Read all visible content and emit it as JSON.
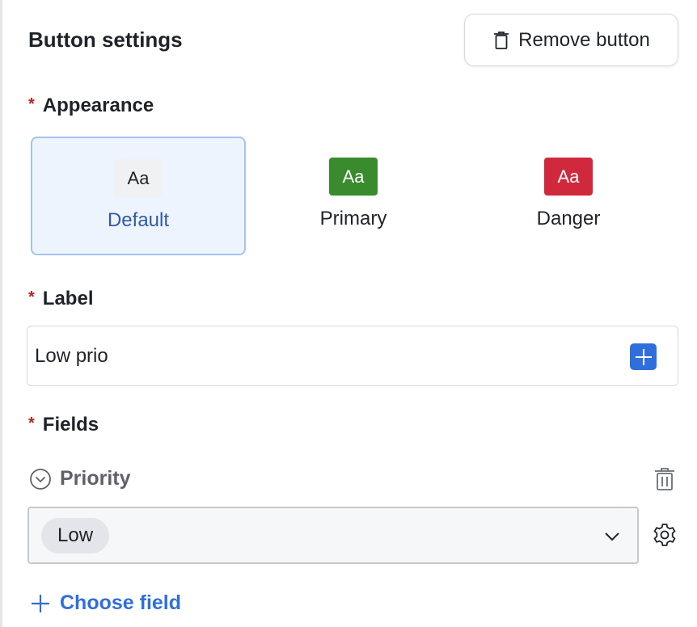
{
  "header": {
    "title": "Button settings",
    "remove_label": "Remove button"
  },
  "appearance": {
    "label": "Appearance",
    "required_mark": "*",
    "sample_text": "Aa",
    "options": [
      {
        "name": "Default",
        "selected": true,
        "color": "#f0f1f3"
      },
      {
        "name": "Primary",
        "selected": false,
        "color": "#3a8a2e"
      },
      {
        "name": "Danger",
        "selected": false,
        "color": "#d0293e"
      }
    ]
  },
  "label_field": {
    "label": "Label",
    "required_mark": "*",
    "value": "Low prio"
  },
  "fields": {
    "label": "Fields",
    "required_mark": "*",
    "items": [
      {
        "name": "Priority",
        "value": "Low"
      }
    ],
    "choose_label": "Choose field"
  },
  "colors": {
    "accent": "#2f6fdb",
    "required": "#b3261e"
  }
}
